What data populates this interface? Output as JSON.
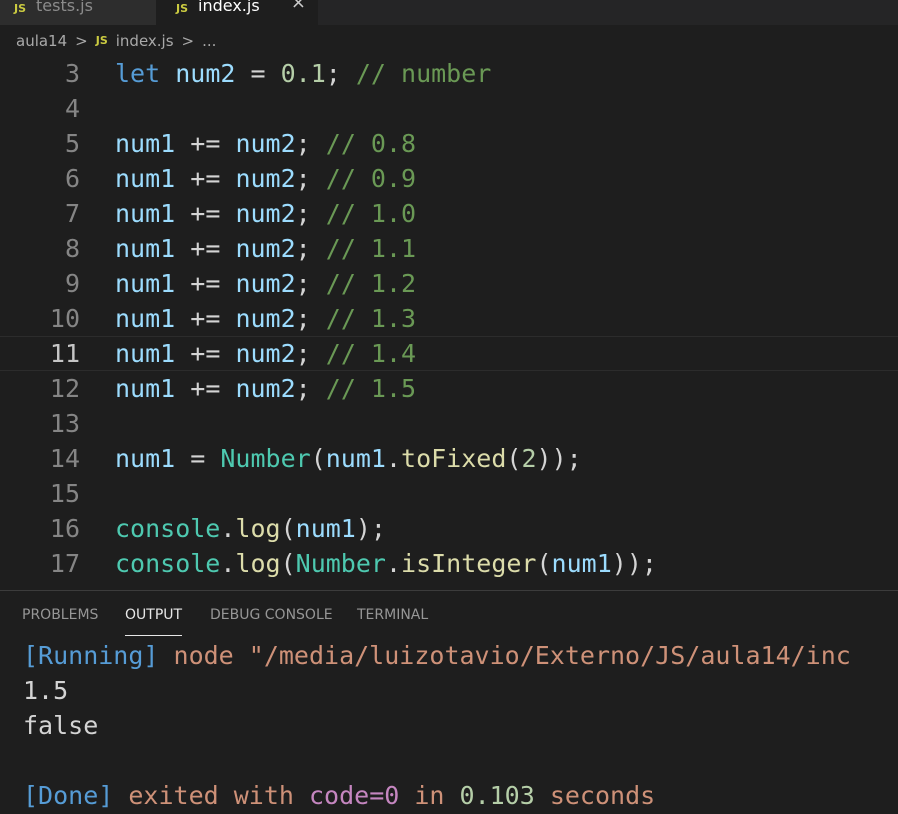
{
  "tabs": [
    {
      "label": "tests.js",
      "badge": "JS",
      "active": false
    },
    {
      "label": "index.js",
      "badge": "JS",
      "active": true,
      "close": "×"
    }
  ],
  "breadcrumb": {
    "folder": "aula14",
    "sep1": ">",
    "badge": "JS",
    "file": "index.js",
    "sep2": ">",
    "more": "..."
  },
  "editor": {
    "lines": [
      {
        "n": "3",
        "t": [
          [
            "kw",
            "let"
          ],
          [
            "op",
            " "
          ],
          [
            "var",
            "num2"
          ],
          [
            "op",
            " = "
          ],
          [
            "num",
            "0.1"
          ],
          [
            "op",
            "; "
          ],
          [
            "cmt",
            "// number"
          ]
        ]
      },
      {
        "n": "4",
        "t": []
      },
      {
        "n": "5",
        "t": [
          [
            "var",
            "num1"
          ],
          [
            "op",
            " += "
          ],
          [
            "var",
            "num2"
          ],
          [
            "op",
            "; "
          ],
          [
            "cmt",
            "// 0.8"
          ]
        ]
      },
      {
        "n": "6",
        "t": [
          [
            "var",
            "num1"
          ],
          [
            "op",
            " += "
          ],
          [
            "var",
            "num2"
          ],
          [
            "op",
            "; "
          ],
          [
            "cmt",
            "// 0.9"
          ]
        ]
      },
      {
        "n": "7",
        "t": [
          [
            "var",
            "num1"
          ],
          [
            "op",
            " += "
          ],
          [
            "var",
            "num2"
          ],
          [
            "op",
            "; "
          ],
          [
            "cmt",
            "// 1.0"
          ]
        ]
      },
      {
        "n": "8",
        "t": [
          [
            "var",
            "num1"
          ],
          [
            "op",
            " += "
          ],
          [
            "var",
            "num2"
          ],
          [
            "op",
            "; "
          ],
          [
            "cmt",
            "// 1.1"
          ]
        ]
      },
      {
        "n": "9",
        "t": [
          [
            "var",
            "num1"
          ],
          [
            "op",
            " += "
          ],
          [
            "var",
            "num2"
          ],
          [
            "op",
            "; "
          ],
          [
            "cmt",
            "// 1.2"
          ]
        ]
      },
      {
        "n": "10",
        "t": [
          [
            "var",
            "num1"
          ],
          [
            "op",
            " += "
          ],
          [
            "var",
            "num2"
          ],
          [
            "op",
            "; "
          ],
          [
            "cmt",
            "// 1.3"
          ]
        ]
      },
      {
        "n": "11",
        "t": [
          [
            "var",
            "num1"
          ],
          [
            "op",
            " += "
          ],
          [
            "var",
            "num2"
          ],
          [
            "op",
            "; "
          ],
          [
            "cmt",
            "// 1.4"
          ]
        ],
        "current": true
      },
      {
        "n": "12",
        "t": [
          [
            "var",
            "num1"
          ],
          [
            "op",
            " += "
          ],
          [
            "var",
            "num2"
          ],
          [
            "op",
            "; "
          ],
          [
            "cmt",
            "// 1.5"
          ]
        ]
      },
      {
        "n": "13",
        "t": []
      },
      {
        "n": "14",
        "t": [
          [
            "var",
            "num1"
          ],
          [
            "op",
            " = "
          ],
          [
            "cls",
            "Number"
          ],
          [
            "op",
            "("
          ],
          [
            "var",
            "num1"
          ],
          [
            "op",
            "."
          ],
          [
            "fn",
            "toFixed"
          ],
          [
            "op",
            "("
          ],
          [
            "num",
            "2"
          ],
          [
            "op",
            "));"
          ]
        ]
      },
      {
        "n": "15",
        "t": []
      },
      {
        "n": "16",
        "t": [
          [
            "cls",
            "console"
          ],
          [
            "op",
            "."
          ],
          [
            "fn",
            "log"
          ],
          [
            "op",
            "("
          ],
          [
            "var",
            "num1"
          ],
          [
            "op",
            ");"
          ]
        ]
      },
      {
        "n": "17",
        "t": [
          [
            "cls",
            "console"
          ],
          [
            "op",
            "."
          ],
          [
            "fn",
            "log"
          ],
          [
            "op",
            "("
          ],
          [
            "cls",
            "Number"
          ],
          [
            "op",
            "."
          ],
          [
            "fn",
            "isInteger"
          ],
          [
            "op",
            "("
          ],
          [
            "var",
            "num1"
          ],
          [
            "op",
            "));"
          ]
        ]
      }
    ]
  },
  "panel": {
    "tabs": [
      "PROBLEMS",
      "OUTPUT",
      "DEBUG CONSOLE",
      "TERMINAL"
    ],
    "active_tab": "OUTPUT",
    "running_tag": "[Running]",
    "running_cmd": " node \"/media/luizotavio/Externo/JS/aula14/inc",
    "output_line1": "1.5",
    "output_line2": "false",
    "done_tag": "[Done]",
    "done_exited": " exited with ",
    "done_code": "code=0",
    "done_in": " in ",
    "done_time": "0.103",
    "done_seconds": " seconds"
  }
}
